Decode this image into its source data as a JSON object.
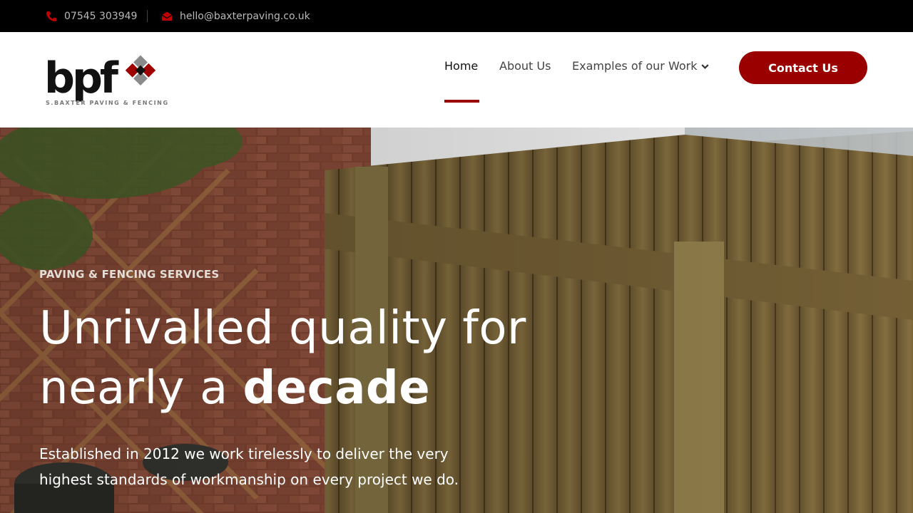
{
  "topbar": {
    "phone": "07545 303949",
    "email": "hello@baxterpaving.co.uk",
    "phone_icon": "phone-icon",
    "email_icon": "envelope-icon"
  },
  "header": {
    "logo_text": "bpf",
    "logo_tagline": "S.BAXTER PAVING & FENCING",
    "nav": [
      {
        "label": "Home",
        "active": true
      },
      {
        "label": "About Us"
      },
      {
        "label": "Examples of our Work",
        "icon": "chevron-down-icon"
      }
    ],
    "cta_label": "Contact Us"
  },
  "hero": {
    "eyebrow": "PAVING & FENCING SERVICES",
    "headline_line1": "Unrivalled quality for",
    "headline_line2_pre": "nearly a ",
    "headline_line2_bold": "decade",
    "lede_line1": "Established in 2012 we work tirelessly to deliver the very",
    "lede_line2": "highest standards of workmanship on every project we do."
  },
  "colors": {
    "brand_red": "#9b0000",
    "topbar_bg": "#000000",
    "logo_grey": "#808080"
  }
}
